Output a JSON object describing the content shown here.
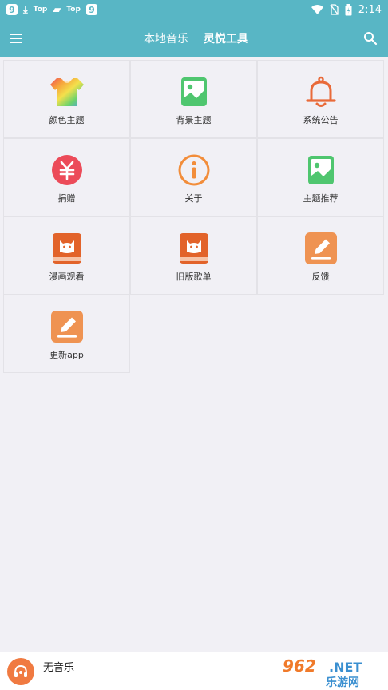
{
  "status_bar": {
    "left_icons": [
      "app-9-icon",
      "download-icon",
      "top-icon",
      "shopping-bag-icon",
      "top-icon",
      "app-9-icon"
    ],
    "badge_9": "9",
    "top_label": "Top",
    "time": "2:14"
  },
  "header": {
    "tabs": [
      {
        "label": "本地音乐",
        "active": false
      },
      {
        "label": "灵悦工具",
        "active": true
      }
    ],
    "accent": "#58b6c5"
  },
  "tools": [
    {
      "label": "颜色主题",
      "icon": "rainbow-shirt-icon"
    },
    {
      "label": "背景主题",
      "icon": "image-icon"
    },
    {
      "label": "系统公告",
      "icon": "bell-icon"
    },
    {
      "label": "捐赠",
      "icon": "yen-icon"
    },
    {
      "label": "关于",
      "icon": "info-icon"
    },
    {
      "label": "主题推荐",
      "icon": "image-icon"
    },
    {
      "label": "漫画观看",
      "icon": "cat-book-icon"
    },
    {
      "label": "旧版歌单",
      "icon": "cat-book-icon"
    },
    {
      "label": "反馈",
      "icon": "edit-icon"
    },
    {
      "label": "更新app",
      "icon": "edit-icon"
    }
  ],
  "player": {
    "title": "无音乐",
    "watermark": "962.NET 乐游网"
  }
}
